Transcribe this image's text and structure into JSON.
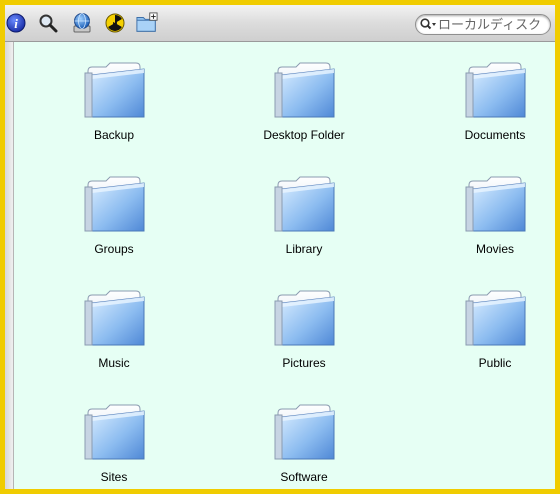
{
  "toolbar": {
    "buttons": [
      {
        "icon": "info-icon"
      },
      {
        "icon": "magnifier-icon"
      },
      {
        "icon": "globe-network-icon"
      },
      {
        "icon": "burn-icon"
      },
      {
        "icon": "new-folder-icon"
      }
    ],
    "search": {
      "placeholder": "ローカルディスク"
    }
  },
  "folders": [
    {
      "name": "Backup"
    },
    {
      "name": "Desktop Folder"
    },
    {
      "name": "Documents"
    },
    {
      "name": "Groups"
    },
    {
      "name": "Library"
    },
    {
      "name": "Movies"
    },
    {
      "name": "Music"
    },
    {
      "name": "Pictures"
    },
    {
      "name": "Public"
    },
    {
      "name": "Sites"
    },
    {
      "name": "Software"
    }
  ],
  "colors": {
    "frame": "#f0cc00",
    "content_bg": "#e6fff4",
    "folder_blue": "#7aaee8"
  }
}
